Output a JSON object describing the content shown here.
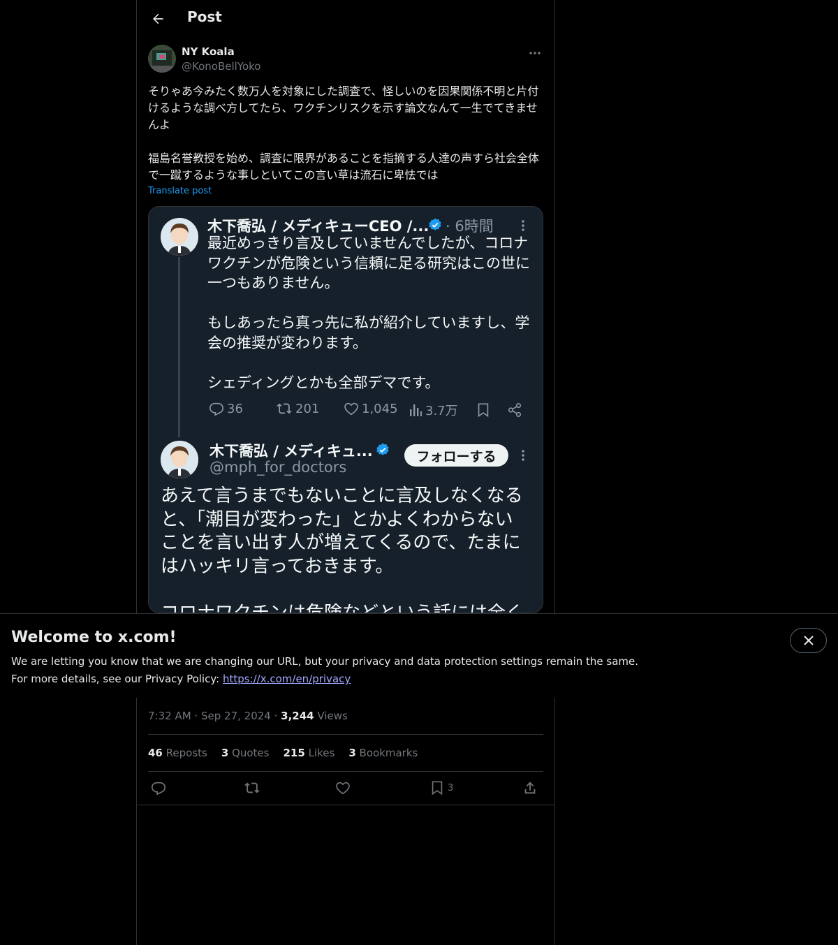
{
  "header": {
    "title": "Post"
  },
  "author": {
    "name": "NY Koala",
    "handle": "@KonoBellYoko"
  },
  "post": {
    "text": "そりゃあ今みたく数万人を対象にした調査で、怪しいのを因果関係不明と片付けるような調べ方してたら、ワクチンリスクを示す論文なんて一生でてきませんよ\n\n福島名誉教授を始め、調査に限界があることを指摘する人達の声すら社会全体で一蹴するような事しといてこの言い草は流石に卑怯では",
    "translate_label": "Translate post"
  },
  "media": {
    "tweet1": {
      "name": "木下喬弘 / メディキューCEO /...",
      "time": "· 6時間",
      "text": "最近めっきり言及していませんでしたが、コロナワクチンが危険という信頼に足る研究はこの世に一つもありません。\n\nもしあったら真っ先に私が紹介していますし、学会の推奨が変わります。\n\nシェディングとかも全部デマです。",
      "replies": "36",
      "reposts": "201",
      "likes": "1,045",
      "views": "3.7万"
    },
    "tweet2": {
      "name": "木下喬弘 / メディキュ...",
      "handle": "@mph_for_doctors",
      "follow_label": "フォローする",
      "text": "あえて言うまでもないことに言及しなくなると、「潮目が変わった」とかよくわからないことを言い出す人が増えてくるので、たまにはハッキリ言っておきます。\n\nコロナワクチンは危険などという話には全く"
    }
  },
  "banner": {
    "title": "Welcome to x.com!",
    "line1": "We are letting you know that we are changing our URL, but your privacy and data protection settings remain the same.",
    "line2": "For more details, see our Privacy Policy: ",
    "link": "https://x.com/en/privacy"
  },
  "meta": {
    "time": "7:32 AM",
    "date": "Sep 27, 2024",
    "views_count": "3,244",
    "views_label": "Views"
  },
  "stats": {
    "reposts_count": "46",
    "reposts_label": "Reposts",
    "quotes_count": "3",
    "quotes_label": "Quotes",
    "likes_count": "215",
    "likes_label": "Likes",
    "bookmarks_count": "3",
    "bookmarks_label": "Bookmarks"
  },
  "actions": {
    "bookmark_count": "3"
  },
  "icons": [
    "back-arrow-icon",
    "more-icon",
    "verified-icon",
    "reply-icon",
    "repost-icon",
    "like-icon",
    "views-icon",
    "bookmark-icon",
    "share-icon",
    "close-icon"
  ],
  "colors": {
    "background": "#000000",
    "accent": "#1d9bf0",
    "muted": "#71767b",
    "border": "#2f3336"
  }
}
